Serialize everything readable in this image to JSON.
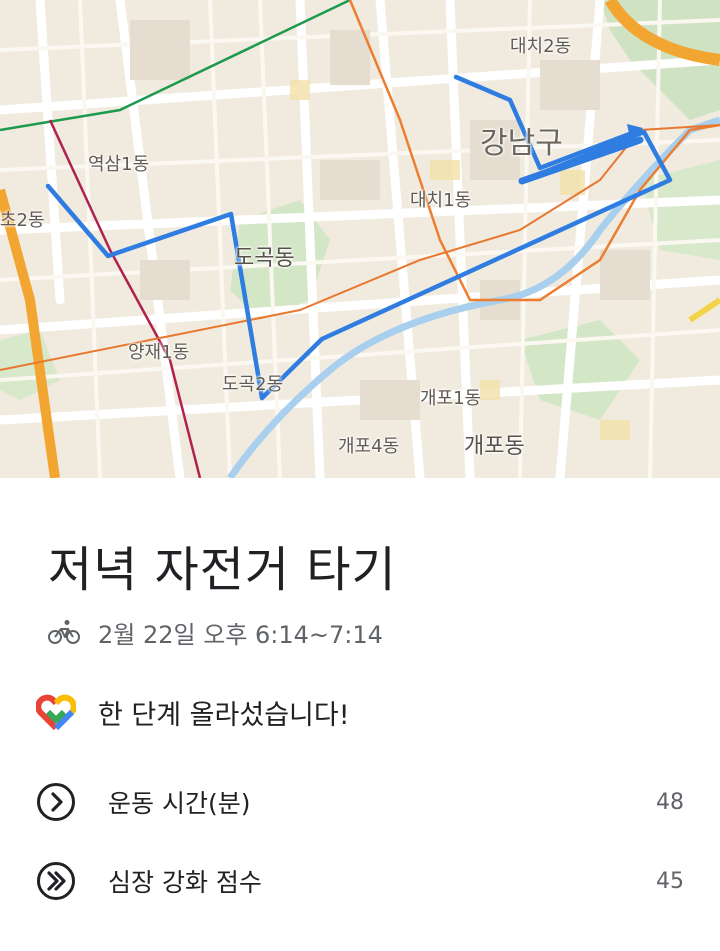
{
  "map": {
    "labels": {
      "daechi2": "대치2동",
      "gangnam": "강남구",
      "yeoksam1": "역삼1동",
      "seocho2": "초2동",
      "daechi1": "대치1동",
      "dogok": "도곡동",
      "yangjae1": "양재1동",
      "dogok2": "도곡2동",
      "gaepo1": "개포1동",
      "gaepo4": "개포4동",
      "gaepo": "개포동"
    },
    "route_color": "#2f7de1"
  },
  "activity": {
    "title": "저녁 자전거 타기",
    "time": "2월 22일 오후 6:14~7:14",
    "type_icon": "bike-icon"
  },
  "goal": {
    "text": "한 단계 올라섰습니다!",
    "icon": "google-fit-heart-icon"
  },
  "metrics": [
    {
      "label": "운동 시간(분)",
      "value": "48",
      "icon": "move-minutes-icon"
    },
    {
      "label": "심장 강화 점수",
      "value": "45",
      "icon": "heart-points-icon"
    }
  ]
}
